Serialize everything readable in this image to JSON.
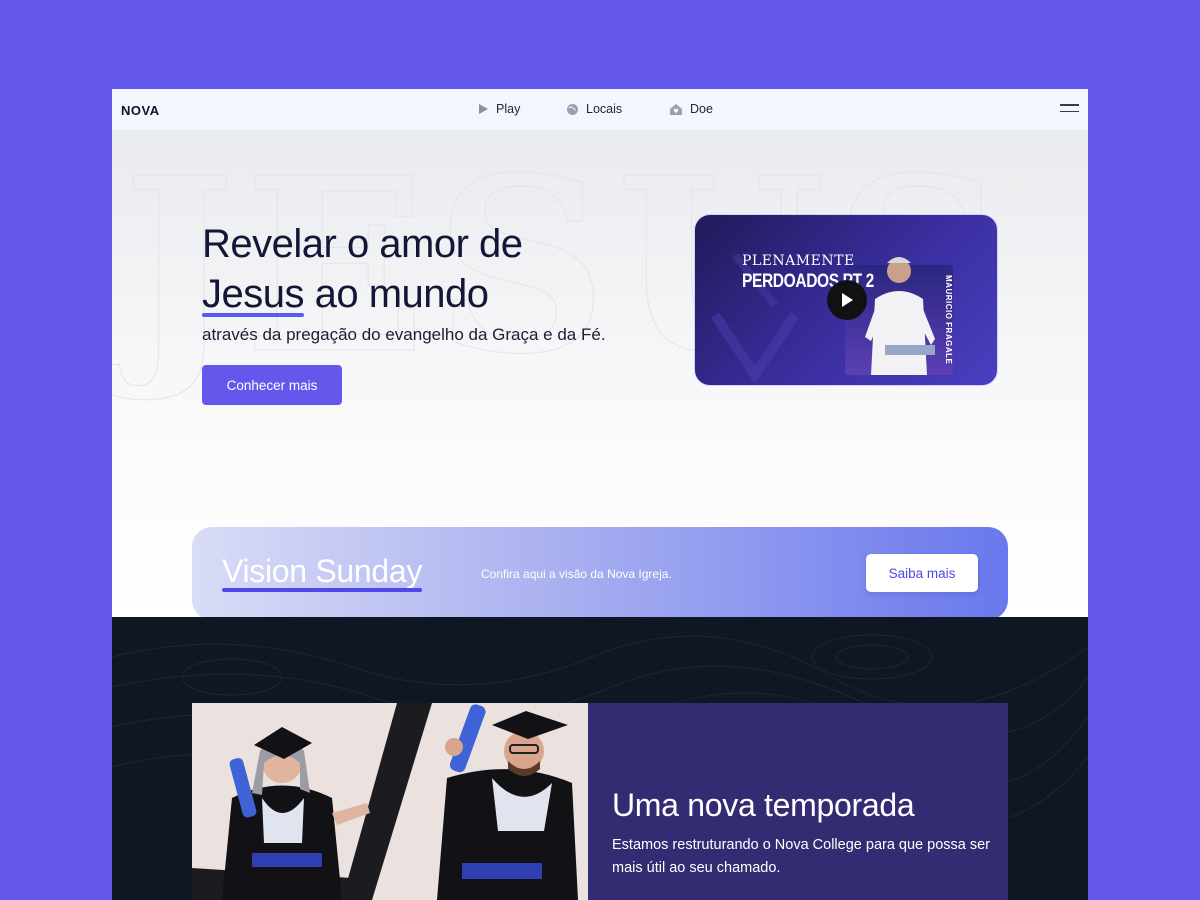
{
  "nav": {
    "logo": "NOVA",
    "items": [
      {
        "label": "Play",
        "icon": "play-icon"
      },
      {
        "label": "Locais",
        "icon": "globe-icon"
      },
      {
        "label": "Doe",
        "icon": "heart-house-icon"
      }
    ],
    "menu_icon": "hamburger-menu-icon"
  },
  "hero": {
    "title_line1": "Revelar o amor de",
    "title_highlight": "Jesus",
    "title_line2_rest": "ao mundo",
    "subtitle": "através da pregação do evangelho da Graça e da Fé.",
    "cta_label": "Conhecer mais",
    "video": {
      "line1": "PLENAMENTE",
      "line2": "PERDOADOS PT 2",
      "side_text": "MAURICIO FRAGALE",
      "play_icon": "play-icon"
    }
  },
  "vision": {
    "title": "Vision Sunday",
    "text": "Confira aqui a visão da Nova Igreja.",
    "button_label": "Saiba mais"
  },
  "season": {
    "title": "Uma nova temporada",
    "text": "Estamos restruturando o Nova College para que possa ser mais útil ao seu chamado."
  },
  "colors": {
    "brand": "#6657ec",
    "accent_underline": "#5b5bf0",
    "dark_bg": "#0f1724",
    "panel_bg": "#342c72"
  }
}
